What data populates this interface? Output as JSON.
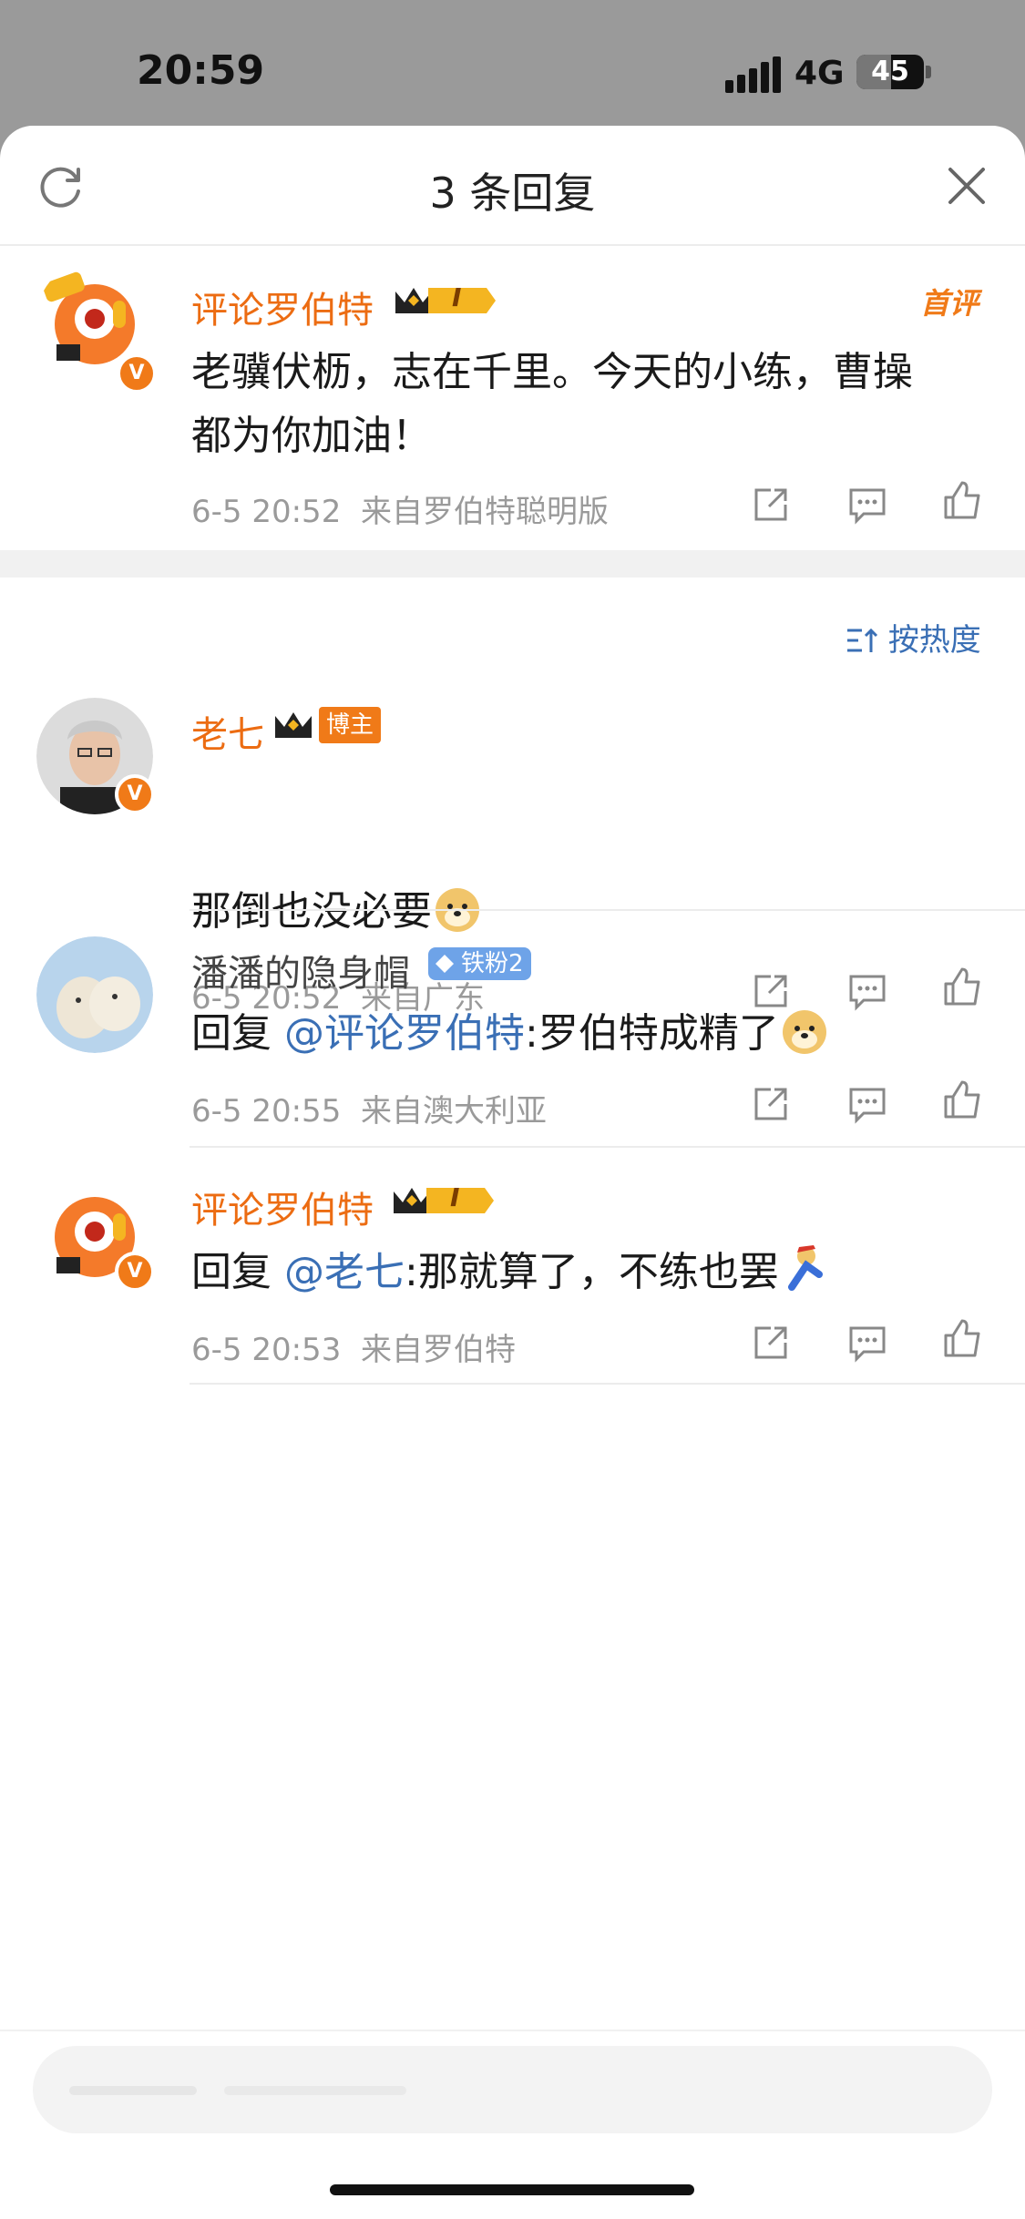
{
  "status": {
    "time": "20:59",
    "network": "4G",
    "battery": "45"
  },
  "header": {
    "title": "3 条回复"
  },
  "main_comment": {
    "user": "评论罗伯特",
    "level": "I",
    "tag": "首评",
    "text": "老骥伏枥，志在千里。今天的小练，曹操都为你加油！",
    "time": "6-5 20:52",
    "source": "来自罗伯特聪明版"
  },
  "sort": {
    "label": "按热度"
  },
  "replies": [
    {
      "user": "老七",
      "badge": "博主",
      "text": "那倒也没必要",
      "time": "6-5 20:52",
      "source": "来自广东"
    },
    {
      "user": "潘潘的隐身帽",
      "badge": "铁粉2",
      "reply_prefix": "回复 ",
      "mention": "@评论罗伯特",
      "text": ":罗伯特成精了",
      "time": "6-5 20:55",
      "source": "来自澳大利亚"
    },
    {
      "user": "评论罗伯特",
      "level": "I",
      "reply_prefix": "回复 ",
      "mention": "@老七",
      "text": ":那就算了，不练也罢",
      "time": "6-5 20:53",
      "source": "来自罗伯特"
    }
  ],
  "icons": {
    "share": "share-icon",
    "comment": "comment-icon",
    "like": "like-icon",
    "refresh": "refresh-icon",
    "close": "close-icon"
  },
  "colors": {
    "username": "#ec6c12",
    "mention": "#3a6fb5",
    "badge": "#f07a18"
  }
}
